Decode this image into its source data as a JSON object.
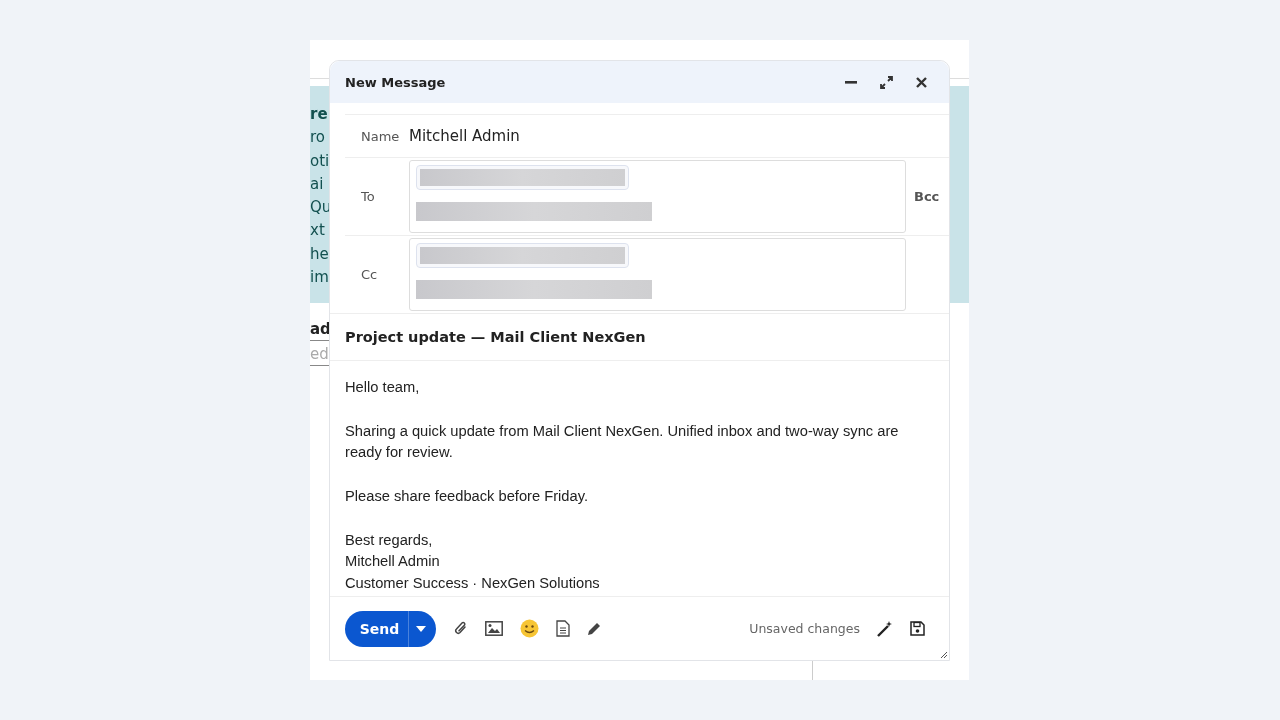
{
  "background": {
    "fragments": [
      {
        "text": "re",
        "bold": true
      },
      {
        "text": "ro",
        "bold": false
      },
      {
        "text": "oti",
        "bold": false
      },
      {
        "text": "ai",
        "bold": false
      },
      {
        "text": "Qu",
        "bold": false
      },
      {
        "text": "xt",
        "bold": false
      },
      {
        "text": "he",
        "bold": false
      },
      {
        "text": "im",
        "bold": false
      }
    ],
    "heading": "ad",
    "placeholder": "ed"
  },
  "dialog": {
    "title": "New Message",
    "fields": [
      {
        "label": "Name",
        "kind": "text",
        "value": "Mitchell Admin"
      },
      {
        "label": "To",
        "kind": "recipients",
        "entries": [
          {
            "kind": "chip"
          },
          {
            "kind": "line"
          }
        ],
        "side_link": "Bcc"
      },
      {
        "label": "Cc",
        "kind": "recipients",
        "entries": [
          {
            "kind": "chip"
          },
          {
            "kind": "line"
          }
        ]
      }
    ],
    "subject": "Project update — Mail Client NexGen",
    "body": [
      {
        "lines": [
          "Hello team,"
        ]
      },
      {
        "lines": [
          "Sharing a quick update from Mail Client NexGen. Unified inbox and two-way sync are ready for review."
        ]
      },
      {
        "lines": [
          "Please share feedback before Friday."
        ]
      },
      {
        "lines": [
          "Best regards,",
          "Mitchell Admin",
          "Customer Success · NexGen Solutions"
        ]
      }
    ],
    "send": "Send",
    "status": "Unsaved changes"
  }
}
